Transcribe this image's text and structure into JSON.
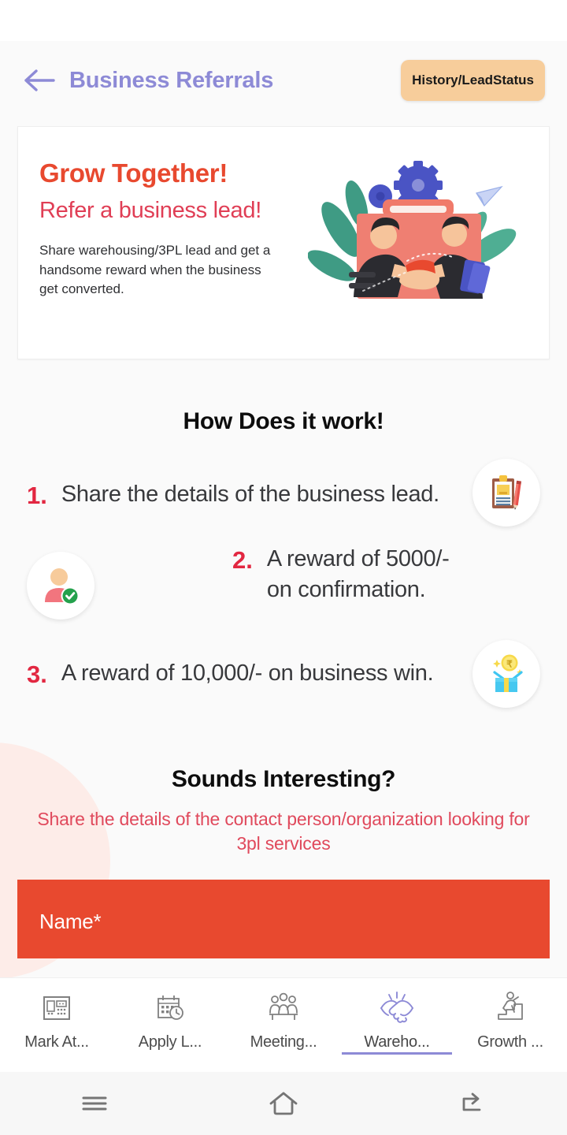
{
  "header": {
    "back_icon": "arrow-left-icon",
    "title": "Business Referrals",
    "history_button": "History/LeadStatus",
    "title_color": "#8d8ad6",
    "history_button_color": "#f7cd9b"
  },
  "hero": {
    "headline": "Grow Together!",
    "subheadline": "Refer a business lead!",
    "description": "Share warehousing/3PL lead and get a handsome reward when the business get converted.",
    "headline_color": "#e8492f",
    "subheadline_color": "#e03e55",
    "illustration": "handshake-briefcase-illustration"
  },
  "how_it_works": {
    "title": "How Does it work!",
    "number_color": "#e22741",
    "steps": [
      {
        "number": "1.",
        "text": "Share the details of the business lead.",
        "icon": "clipboard-pencil-icon",
        "icon_side": "right"
      },
      {
        "number": "2.",
        "text": "A reward of 5000/- on confirmation.",
        "icon": "verified-person-icon",
        "icon_side": "left"
      },
      {
        "number": "3.",
        "text": "A reward of 10,000/- on business win.",
        "icon": "gift-coin-icon",
        "icon_side": "right"
      }
    ]
  },
  "interest": {
    "title": "Sounds Interesting?",
    "subtitle": "Share the details of the contact person/organization looking for 3pl services",
    "subtitle_color": "#e0495c"
  },
  "form": {
    "name_label": "Name*",
    "background_color": "#e8492f"
  },
  "tabbar": {
    "active_color": "#8d8ad6",
    "items": [
      {
        "label": "Mark At...",
        "icon": "attendance-keypad-icon",
        "active": false
      },
      {
        "label": "Apply L...",
        "icon": "calendar-clock-icon",
        "active": false
      },
      {
        "label": "Meeting...",
        "icon": "meeting-people-icon",
        "active": false
      },
      {
        "label": "Wareho...",
        "icon": "handshake-icon",
        "active": true
      },
      {
        "label": "Growth ...",
        "icon": "growth-stairs-icon",
        "active": false
      }
    ]
  },
  "android_nav": {
    "items": [
      {
        "icon": "recents-menu-icon"
      },
      {
        "icon": "home-icon"
      },
      {
        "icon": "back-icon"
      }
    ]
  }
}
